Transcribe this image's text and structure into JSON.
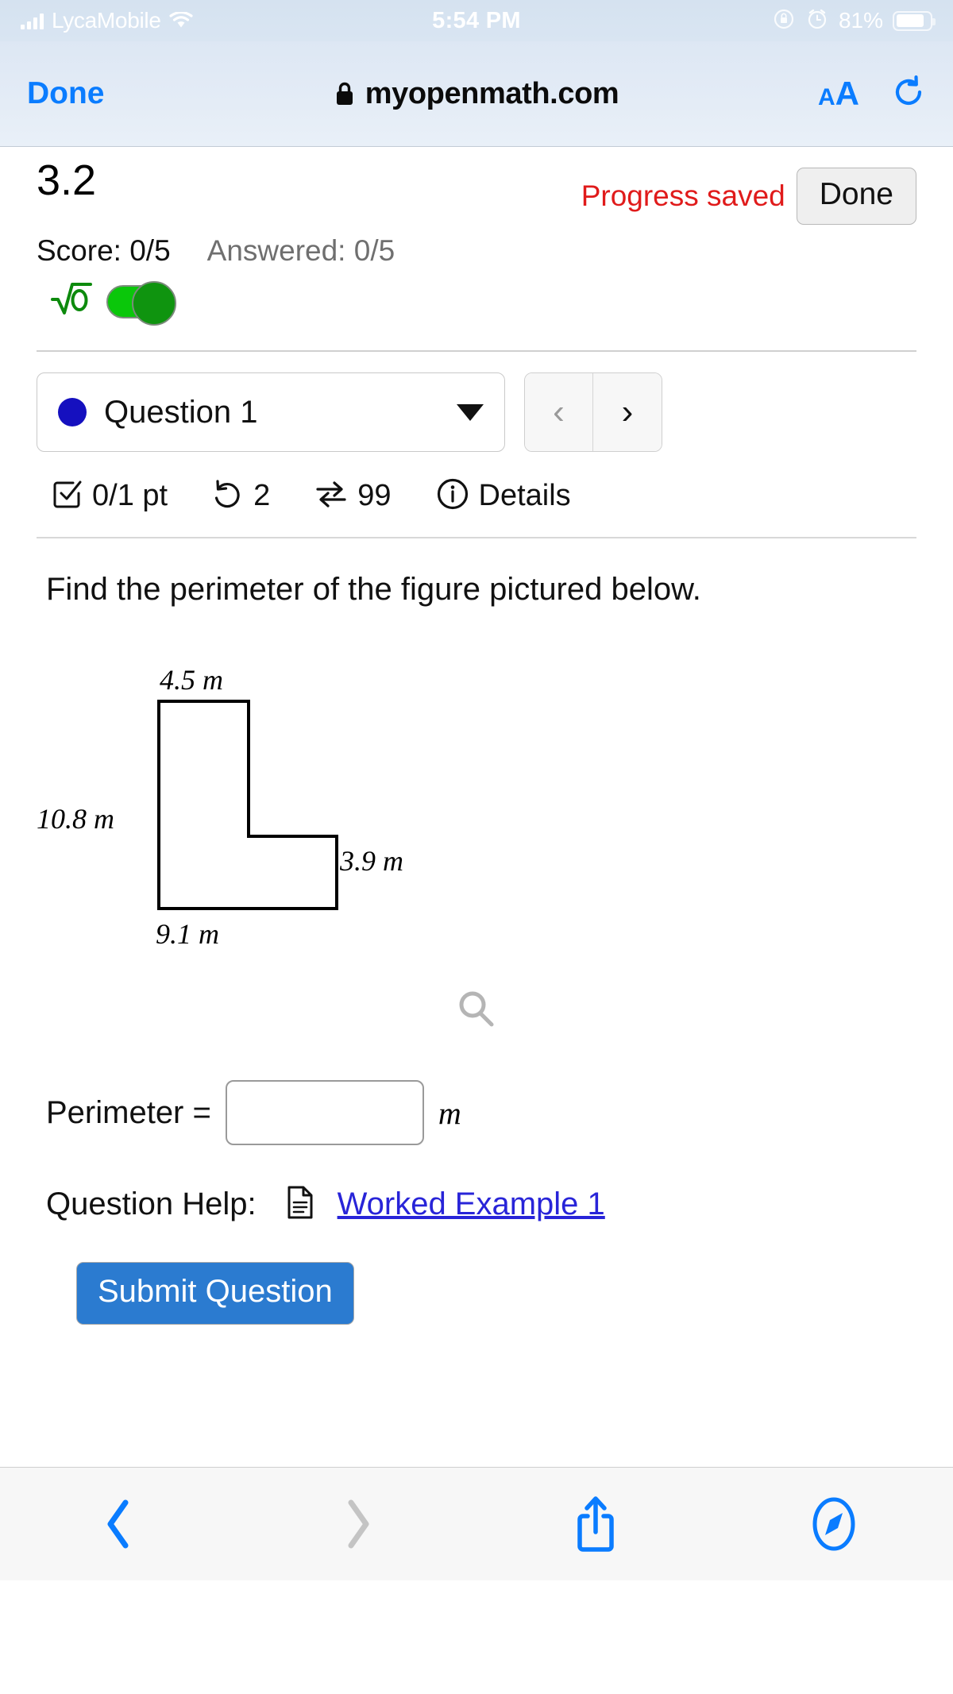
{
  "status_bar": {
    "carrier": "LycaMobile",
    "time": "5:54 PM",
    "battery_percent": "81%",
    "icons": [
      "signal-bars-icon",
      "wifi-icon",
      "rotation-lock-icon",
      "alarm-clock-icon",
      "battery-icon"
    ]
  },
  "browser": {
    "done_label": "Done",
    "url": "myopenmath.com",
    "lock_icon": "lock-icon",
    "text_size_small": "A",
    "text_size_large": "A",
    "reload_icon": "reload-icon"
  },
  "assignment": {
    "title": "3.2",
    "progress_status": "Progress saved",
    "done_button": "Done",
    "score": "Score: 0/5",
    "answered": "Answered: 0/5",
    "radical_icon": "√0",
    "toggle_state": "on"
  },
  "question_selector": {
    "current": "Question 1",
    "dot_color": "#1510bf",
    "prev_label": "‹",
    "next_label": "›"
  },
  "question_meta": {
    "points": "0/1 pt",
    "attempts": "2",
    "versions": "99",
    "details_label": "Details",
    "icons": [
      "checkbox-icon",
      "undo-icon",
      "swap-icon",
      "info-icon"
    ]
  },
  "question": {
    "prompt": "Find the perimeter of the figure pictured below.",
    "zoom_icon": "magnifier-icon"
  },
  "figure": {
    "type": "L-shaped polygon",
    "labels": {
      "top": "4.5 m",
      "left": "10.8 m",
      "right": "3.9 m",
      "bottom": "9.1 m"
    }
  },
  "answer": {
    "label": "Perimeter =",
    "value": "",
    "placeholder": "",
    "unit": "m"
  },
  "help": {
    "label": "Question Help:",
    "link_text": "Worked Example 1",
    "doc_icon": "document-icon"
  },
  "submit": {
    "label": "Submit Question",
    "color": "#2b7bd0"
  },
  "bottom_toolbar": {
    "back_icon": "chevron-left-icon",
    "forward_icon": "chevron-right-icon",
    "share_icon": "share-icon",
    "tabs_icon": "safari-compass-icon"
  }
}
